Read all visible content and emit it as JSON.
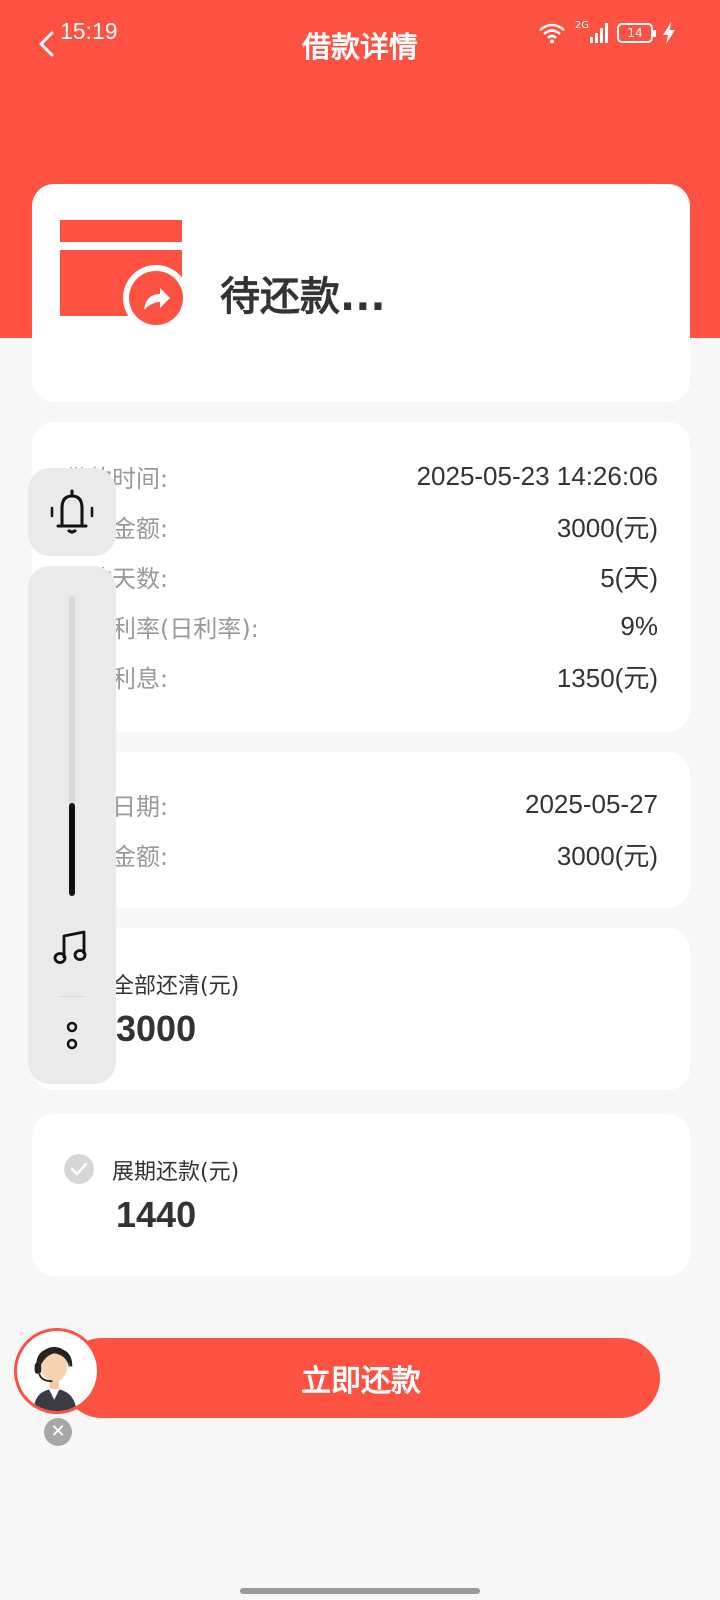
{
  "status_bar": {
    "time": "15:19",
    "network": "2G",
    "battery": "14"
  },
  "header": {
    "title": "借款详情"
  },
  "loan_status": {
    "text": "待还款..."
  },
  "loan_info": [
    {
      "label": "借款时间:",
      "value": "2025-05-23 14:26:06"
    },
    {
      "label": "借款金额:",
      "value": "3000(元)"
    },
    {
      "label": "借款天数:",
      "value": "5(天)"
    },
    {
      "label": "借款利率(日利率):",
      "value": "9%"
    },
    {
      "label": "借款利息:",
      "value": "1350(元)"
    }
  ],
  "repayment_info": [
    {
      "label": "还款日期:",
      "value": "2025-05-27"
    },
    {
      "label": "还款金额:",
      "value": "3000(元)"
    }
  ],
  "pay_options": {
    "full": {
      "label": "全部还清(元)",
      "amount": "3000"
    },
    "extension": {
      "label": "展期还款(元)",
      "amount": "1440"
    }
  },
  "submit_button": "立即还款",
  "volume_level": 0.31,
  "colors": {
    "primary": "#fd5142",
    "background": "#f7f7f7",
    "card": "#ffffff",
    "label_gray": "#999999"
  },
  "icons": [
    "back-icon",
    "wifi-icon",
    "signal-icon",
    "battery-icon",
    "charging-icon",
    "wallet-icon",
    "bell-icon",
    "music-icon",
    "more-icon",
    "check-icon",
    "customer-service-avatar",
    "close-icon"
  ]
}
